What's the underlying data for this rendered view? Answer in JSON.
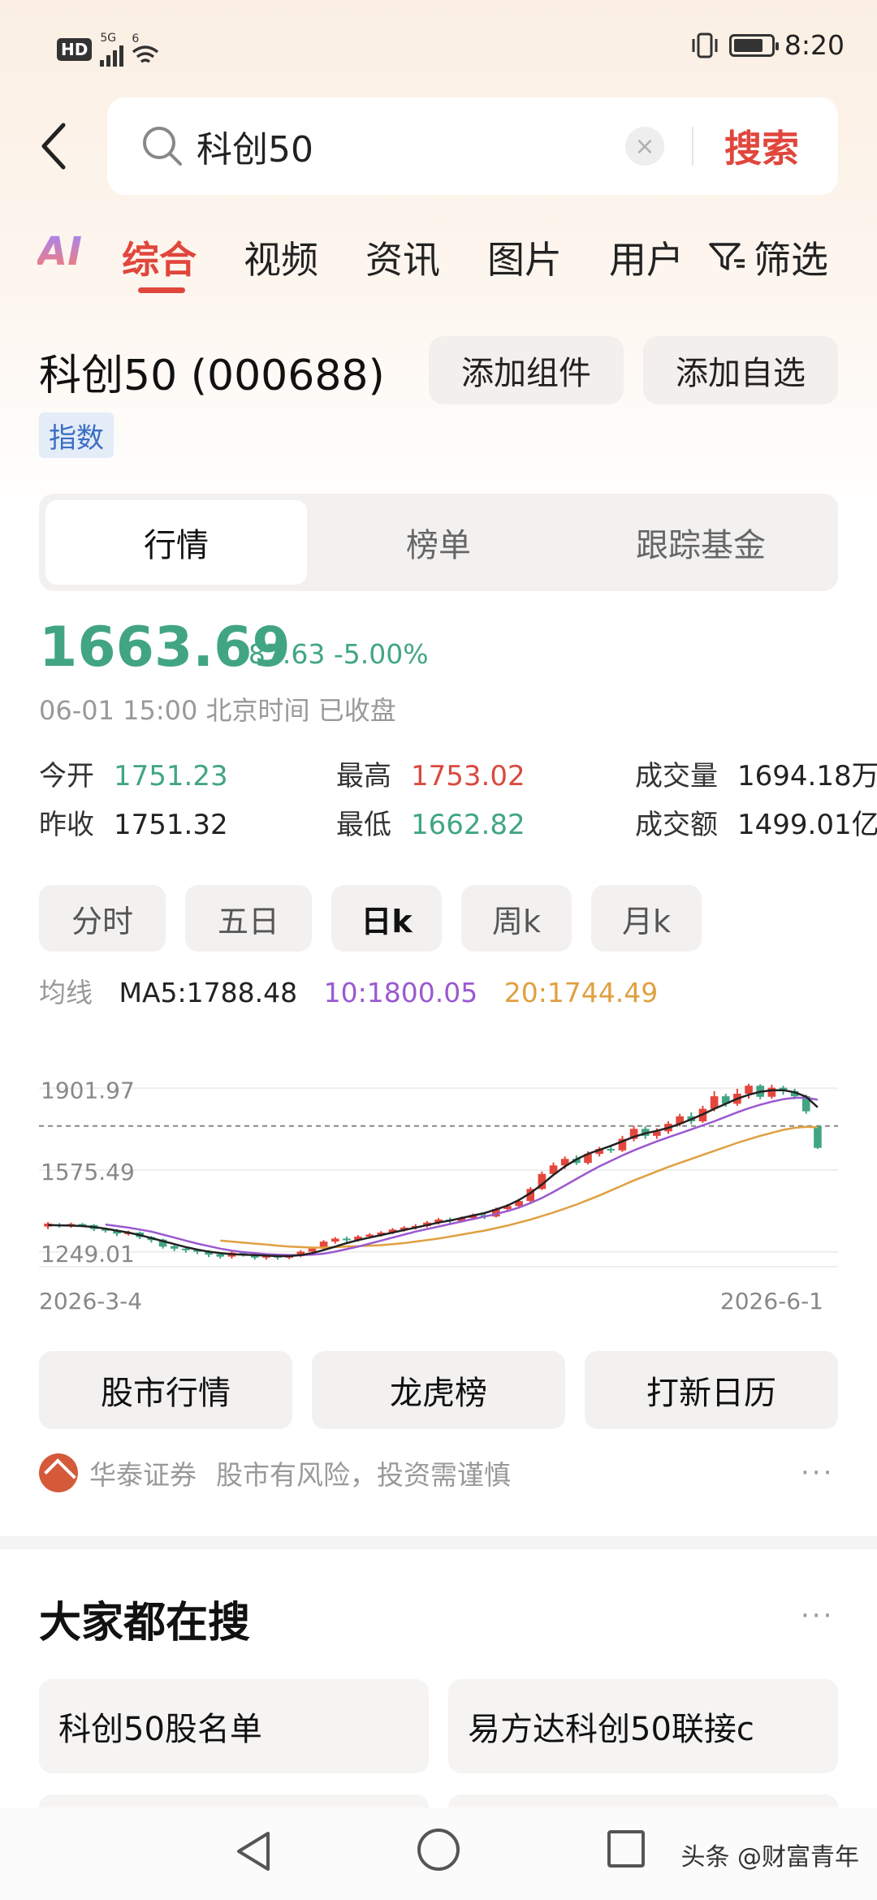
{
  "status_bar": {
    "hd": "HD",
    "net1": "5G",
    "net2": "6",
    "time": "8:20"
  },
  "search": {
    "query": "科创50",
    "submit_label": "搜索"
  },
  "tabs": {
    "ai": "AI",
    "items": [
      "综合",
      "视频",
      "资讯",
      "图片",
      "用户"
    ],
    "filter": "筛选",
    "active_index": 0
  },
  "index": {
    "title": "科创50 (000688)",
    "tag": "指数",
    "add_widget": "添加组件",
    "add_watch": "添加自选"
  },
  "segments": [
    "行情",
    "榜单",
    "跟踪基金"
  ],
  "quote": {
    "price": "1663.69",
    "change": "-87.63",
    "change_pct": "-5.00%",
    "time_info": "06-01 15:00 北京时间 已收盘",
    "open_label": "今开",
    "open": "1751.23",
    "high_label": "最高",
    "high": "1753.02",
    "volume_label": "成交量",
    "volume": "1694.18万",
    "prev_close_label": "昨收",
    "prev_close": "1751.32",
    "low_label": "最低",
    "low": "1662.82",
    "amount_label": "成交额",
    "amount": "1499.01亿"
  },
  "periods": [
    "分时",
    "五日",
    "日k",
    "周k",
    "月k"
  ],
  "active_period": 2,
  "ma": {
    "label": "均线",
    "ma5": "MA5:1788.48",
    "ma10": "10:1800.05",
    "ma20": "20:1744.49"
  },
  "chart_data": {
    "type": "candlestick",
    "y_ticks": [
      "1901.97",
      "1575.49",
      "1249.01"
    ],
    "ylim": [
      1190,
      2000
    ],
    "x_start": "2026-3-4",
    "x_end": "2026-6-1",
    "reference_line": 1751.32,
    "colors": {
      "up": "#e5463c",
      "down": "#41a584",
      "ma5": "#222222",
      "ma10": "#9b59d0",
      "ma20": "#e0a040"
    },
    "candles": [
      [
        1350,
        1362,
        1340,
        1368
      ],
      [
        1358,
        1352,
        1346,
        1364
      ],
      [
        1352,
        1360,
        1345,
        1366
      ],
      [
        1360,
        1356,
        1348,
        1364
      ],
      [
        1356,
        1340,
        1332,
        1360
      ],
      [
        1340,
        1334,
        1326,
        1346
      ],
      [
        1336,
        1322,
        1312,
        1340
      ],
      [
        1324,
        1326,
        1314,
        1334
      ],
      [
        1326,
        1308,
        1300,
        1330
      ],
      [
        1308,
        1296,
        1286,
        1312
      ],
      [
        1298,
        1270,
        1262,
        1302
      ],
      [
        1272,
        1262,
        1252,
        1280
      ],
      [
        1262,
        1256,
        1246,
        1270
      ],
      [
        1256,
        1250,
        1240,
        1262
      ],
      [
        1250,
        1238,
        1228,
        1256
      ],
      [
        1240,
        1230,
        1222,
        1246
      ],
      [
        1230,
        1246,
        1222,
        1252
      ],
      [
        1246,
        1240,
        1230,
        1252
      ],
      [
        1240,
        1226,
        1218,
        1246
      ],
      [
        1226,
        1236,
        1218,
        1242
      ],
      [
        1236,
        1226,
        1218,
        1240
      ],
      [
        1226,
        1232,
        1220,
        1240
      ],
      [
        1232,
        1250,
        1228,
        1256
      ],
      [
        1250,
        1262,
        1244,
        1268
      ],
      [
        1262,
        1290,
        1256,
        1296
      ],
      [
        1290,
        1302,
        1282,
        1308
      ],
      [
        1302,
        1296,
        1288,
        1310
      ],
      [
        1296,
        1310,
        1290,
        1316
      ],
      [
        1310,
        1318,
        1302,
        1324
      ],
      [
        1318,
        1326,
        1310,
        1332
      ],
      [
        1326,
        1338,
        1320,
        1344
      ],
      [
        1338,
        1346,
        1330,
        1352
      ],
      [
        1346,
        1352,
        1338,
        1360
      ],
      [
        1352,
        1366,
        1346,
        1372
      ],
      [
        1366,
        1378,
        1358,
        1384
      ],
      [
        1378,
        1372,
        1362,
        1386
      ],
      [
        1372,
        1384,
        1366,
        1390
      ],
      [
        1384,
        1396,
        1376,
        1402
      ],
      [
        1396,
        1390,
        1380,
        1404
      ],
      [
        1390,
        1420,
        1386,
        1426
      ],
      [
        1420,
        1432,
        1410,
        1440
      ],
      [
        1432,
        1452,
        1426,
        1460
      ],
      [
        1452,
        1500,
        1446,
        1508
      ],
      [
        1500,
        1560,
        1496,
        1570
      ],
      [
        1560,
        1594,
        1552,
        1606
      ],
      [
        1594,
        1620,
        1580,
        1630
      ],
      [
        1620,
        1604,
        1596,
        1634
      ],
      [
        1604,
        1640,
        1598,
        1650
      ],
      [
        1640,
        1660,
        1630,
        1668
      ],
      [
        1660,
        1654,
        1644,
        1676
      ],
      [
        1654,
        1700,
        1648,
        1712
      ],
      [
        1700,
        1740,
        1690,
        1752
      ],
      [
        1740,
        1712,
        1700,
        1750
      ],
      [
        1712,
        1730,
        1700,
        1742
      ],
      [
        1730,
        1760,
        1720,
        1770
      ],
      [
        1760,
        1790,
        1750,
        1800
      ],
      [
        1790,
        1770,
        1758,
        1806
      ],
      [
        1770,
        1820,
        1764,
        1832
      ],
      [
        1820,
        1870,
        1810,
        1890
      ],
      [
        1870,
        1840,
        1828,
        1880
      ],
      [
        1840,
        1880,
        1832,
        1900
      ],
      [
        1880,
        1912,
        1860,
        1920
      ],
      [
        1912,
        1868,
        1858,
        1918
      ],
      [
        1868,
        1904,
        1860,
        1916
      ],
      [
        1904,
        1890,
        1876,
        1912
      ],
      [
        1890,
        1870,
        1858,
        1900
      ],
      [
        1870,
        1810,
        1800,
        1876
      ],
      [
        1751,
        1664,
        1660,
        1753
      ]
    ],
    "ma5": [
      1356,
      1355,
      1354,
      1352,
      1348,
      1342,
      1334,
      1326,
      1316,
      1304,
      1292,
      1280,
      1268,
      1258,
      1250,
      1244,
      1240,
      1238,
      1236,
      1234,
      1232,
      1232,
      1236,
      1244,
      1256,
      1270,
      1284,
      1296,
      1306,
      1316,
      1326,
      1336,
      1346,
      1356,
      1366,
      1374,
      1384,
      1394,
      1404,
      1418,
      1434,
      1456,
      1484,
      1518,
      1556,
      1590,
      1618,
      1640,
      1656,
      1672,
      1690,
      1708,
      1722,
      1732,
      1744,
      1760,
      1778,
      1798,
      1820,
      1840,
      1860,
      1876,
      1888,
      1894,
      1894,
      1886,
      1868,
      1826
    ],
    "ma10": [
      null,
      null,
      null,
      null,
      null,
      1358,
      1352,
      1346,
      1338,
      1330,
      1318,
      1306,
      1294,
      1282,
      1272,
      1262,
      1254,
      1248,
      1244,
      1240,
      1238,
      1236,
      1236,
      1238,
      1242,
      1250,
      1260,
      1270,
      1282,
      1294,
      1306,
      1318,
      1330,
      1340,
      1350,
      1360,
      1370,
      1380,
      1390,
      1400,
      1412,
      1426,
      1444,
      1464,
      1488,
      1514,
      1540,
      1566,
      1590,
      1612,
      1634,
      1654,
      1672,
      1690,
      1706,
      1722,
      1738,
      1754,
      1770,
      1788,
      1806,
      1822,
      1836,
      1848,
      1858,
      1864,
      1864,
      1856
    ],
    "ma20": [
      null,
      null,
      null,
      null,
      null,
      null,
      null,
      null,
      null,
      null,
      null,
      null,
      null,
      null,
      null,
      1294,
      1290,
      1286,
      1282,
      1278,
      1274,
      1270,
      1268,
      1266,
      1266,
      1268,
      1270,
      1272,
      1274,
      1276,
      1280,
      1284,
      1290,
      1296,
      1302,
      1310,
      1318,
      1326,
      1334,
      1344,
      1354,
      1366,
      1378,
      1392,
      1406,
      1422,
      1438,
      1456,
      1474,
      1494,
      1514,
      1534,
      1552,
      1570,
      1588,
      1604,
      1620,
      1636,
      1652,
      1668,
      1684,
      1698,
      1712,
      1724,
      1736,
      1744,
      1748,
      1746
    ]
  },
  "quick_links": [
    "股市行情",
    "龙虎榜",
    "打新日历"
  ],
  "broker": {
    "name": "华泰证券",
    "notice": "股市有风险，投资需谨慎",
    "more": "···"
  },
  "hot": {
    "title": "大家都在搜",
    "more": "···",
    "items": [
      "科创50股名单",
      "易方达科创50联接c"
    ]
  },
  "watermark": "头条 @财富青年"
}
